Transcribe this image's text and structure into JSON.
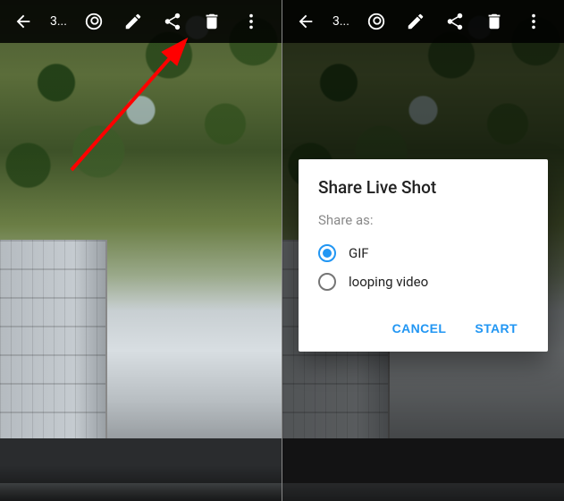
{
  "left": {
    "toolbar": {
      "counter": "3..."
    }
  },
  "right": {
    "toolbar": {
      "counter": "3..."
    },
    "dialog": {
      "title": "Share Live Shot",
      "subhead": "Share as:",
      "options": {
        "gif": "GIF",
        "looping_video": "looping video"
      },
      "actions": {
        "cancel": "CANCEL",
        "start": "START"
      }
    }
  }
}
